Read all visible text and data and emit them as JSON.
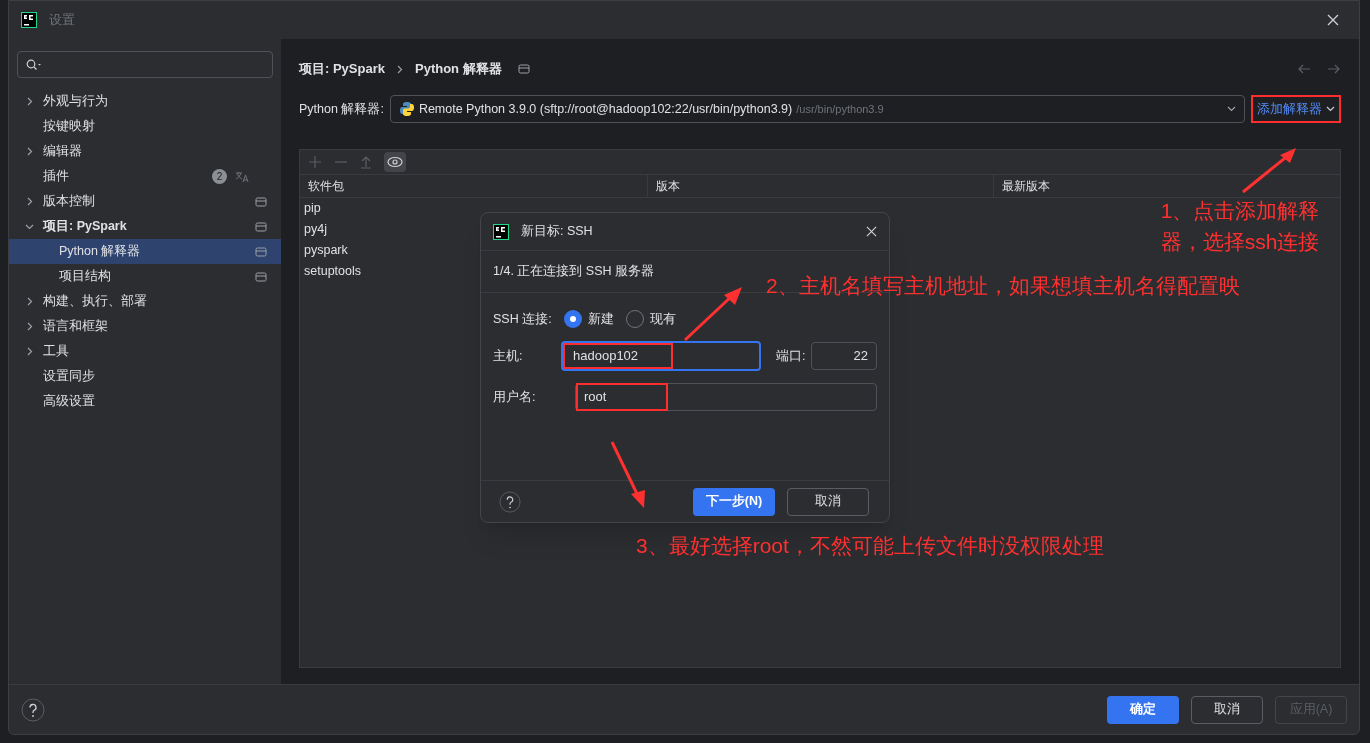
{
  "window": {
    "title": "设置"
  },
  "sidebar": {
    "items": [
      {
        "label": "外观与行为",
        "kind": "group",
        "expanded": false,
        "selected": false,
        "scoped": false
      },
      {
        "label": "按键映射",
        "kind": "leaf",
        "selected": false,
        "scoped": false
      },
      {
        "label": "编辑器",
        "kind": "group",
        "expanded": false,
        "selected": false,
        "scoped": false
      },
      {
        "label": "插件",
        "kind": "leaf",
        "selected": false,
        "scoped": false,
        "badge": "2"
      },
      {
        "label": "版本控制",
        "kind": "group",
        "expanded": false,
        "selected": false,
        "scoped": true
      },
      {
        "label": "项目: PySpark",
        "kind": "group",
        "expanded": true,
        "selected": false,
        "scoped": true,
        "children": [
          {
            "label": "Python 解释器",
            "selected": true,
            "scoped": true
          },
          {
            "label": "项目结构",
            "selected": false,
            "scoped": true
          }
        ]
      },
      {
        "label": "构建、执行、部署",
        "kind": "group",
        "expanded": false,
        "selected": false,
        "scoped": false
      },
      {
        "label": "语言和框架",
        "kind": "group",
        "expanded": false,
        "selected": false,
        "scoped": false
      },
      {
        "label": "工具",
        "kind": "group",
        "expanded": false,
        "selected": false,
        "scoped": false
      },
      {
        "label": "设置同步",
        "kind": "leaf",
        "selected": false,
        "scoped": false
      },
      {
        "label": "高级设置",
        "kind": "leaf",
        "selected": false,
        "scoped": false
      }
    ]
  },
  "breadcrumb": [
    "项目: PySpark",
    "Python 解释器"
  ],
  "interpreter": {
    "label": "Python 解释器:",
    "value": "Remote Python 3.9.0 (sftp://root@hadoop102:22/usr/bin/python3.9)",
    "path": "/usr/bin/python3.9",
    "add_button": "添加解释器"
  },
  "packages": {
    "columns": [
      "软件包",
      "版本",
      "最新版本"
    ],
    "rows": [
      "pip",
      "py4j",
      "pyspark",
      "setuptools"
    ]
  },
  "dialog": {
    "title": "新目标: SSH",
    "step": "1/4. 正在连接到 SSH 服务器",
    "ssh_label": "SSH 连接:",
    "options": [
      {
        "label": "新建",
        "selected": true
      },
      {
        "label": "现有",
        "selected": false
      }
    ],
    "host_label": "主机:",
    "host": "hadoop102",
    "port_label": "端口:",
    "port": "22",
    "user_label": "用户名:",
    "user": "root",
    "next_button": "下一步(N)",
    "cancel_button": "取消"
  },
  "footer": {
    "buttons": [
      {
        "label": "确定",
        "kind": "primary",
        "disabled": false
      },
      {
        "label": "取消",
        "kind": "secondary",
        "disabled": false
      },
      {
        "label": "应用(A)",
        "kind": "secondary",
        "disabled": true
      }
    ]
  },
  "annotations": [
    "1、点击添加解释器，选择ssh连接",
    "2、主机名填写主机地址，如果想填主机名得配置映",
    "3、最好选择root，不然可能上传文件时没权限处理"
  ]
}
